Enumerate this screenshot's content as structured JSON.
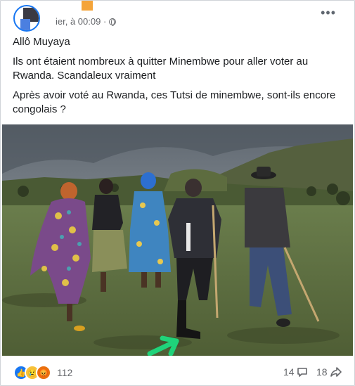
{
  "post": {
    "timestamp": "ier, à 00:09 ·",
    "lines": [
      "Allô Muyaya",
      "Ils ont étaient nombreux à quitter Minembwe pour aller voter au Rwanda. Scandaleux vraiment",
      "Après avoir voté au Rwanda, ces Tutsi de minembwe, sont-ils encore congolais ?"
    ]
  },
  "footer": {
    "reaction_count": "112",
    "comment_count": "14",
    "share_count": "18"
  },
  "icons": {
    "more": "more-icon",
    "globe": "globe-icon",
    "comment": "comment-icon",
    "share": "share-icon"
  },
  "colors": {
    "accent": "#1877f2",
    "text": "#1c1e21",
    "muted": "#65676b",
    "arrow": "#1fd37a"
  }
}
